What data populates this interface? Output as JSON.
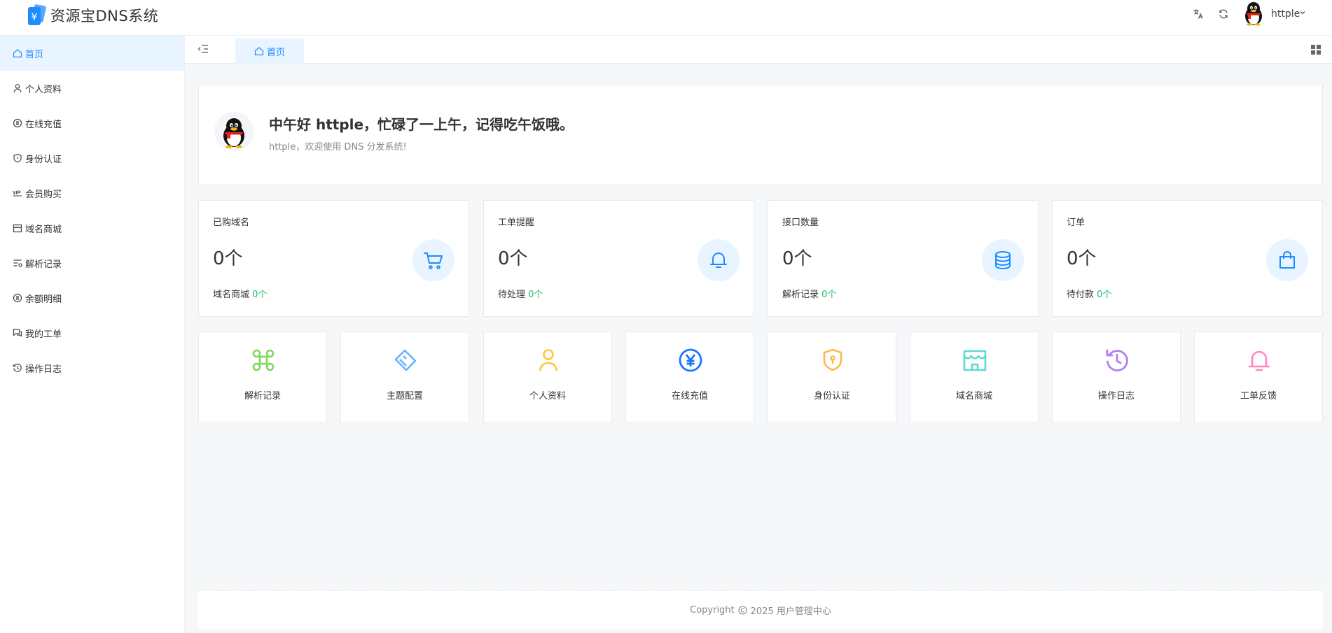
{
  "app": {
    "title": "资源宝DNS系统"
  },
  "header": {
    "username": "httple"
  },
  "sidebar": {
    "items": [
      {
        "label": "首页",
        "icon": "home-icon",
        "active": true
      },
      {
        "label": "个人资料",
        "icon": "user-icon"
      },
      {
        "label": "在线充值",
        "icon": "coin-icon"
      },
      {
        "label": "身份认证",
        "icon": "shield-icon"
      },
      {
        "label": "会员购买",
        "icon": "vip-icon"
      },
      {
        "label": "域名商城",
        "icon": "store-icon"
      },
      {
        "label": "解析记录",
        "icon": "list-icon"
      },
      {
        "label": "余额明细",
        "icon": "coin-icon"
      },
      {
        "label": "我的工单",
        "icon": "chat-icon"
      },
      {
        "label": "操作日志",
        "icon": "history-icon"
      }
    ]
  },
  "tabs": [
    {
      "label": "首页",
      "icon": "home-icon"
    }
  ],
  "welcome": {
    "title": "中午好 httple，忙碌了一上午，记得吃午饭哦。",
    "subtitle": "httple，欢迎使用 DNS 分发系统!"
  },
  "stats": [
    {
      "label": "已购域名",
      "value": "0个",
      "foot_label": "域名商城",
      "foot_value": "0个",
      "icon": "cart-icon"
    },
    {
      "label": "工单提醒",
      "value": "0个",
      "foot_label": "待处理",
      "foot_value": "0个",
      "icon": "bell-icon"
    },
    {
      "label": "接口数量",
      "value": "0个",
      "foot_label": "解析记录",
      "foot_value": "0个",
      "icon": "database-icon"
    },
    {
      "label": "订单",
      "value": "0个",
      "foot_label": "待付款",
      "foot_value": "0个",
      "icon": "shopping-bag-icon"
    }
  ],
  "quick_links": [
    {
      "label": "解析记录",
      "icon": "command-icon",
      "color": "#7ed957"
    },
    {
      "label": "主题配置",
      "icon": "brush-icon",
      "color": "#69b1ff"
    },
    {
      "label": "个人资料",
      "icon": "user-icon",
      "color": "#ffc53d"
    },
    {
      "label": "在线充值",
      "icon": "yen-coin-icon",
      "color": "#1677ff"
    },
    {
      "label": "身份认证",
      "icon": "shield-icon",
      "color": "#ffb84d"
    },
    {
      "label": "域名商城",
      "icon": "store-icon",
      "color": "#5cdbd3"
    },
    {
      "label": "操作日志",
      "icon": "history-icon",
      "color": "#b37feb"
    },
    {
      "label": "工单反馈",
      "icon": "bell-icon",
      "color": "#ff85c0"
    }
  ],
  "footer": {
    "copyright_prefix": "Copyright",
    "copyright_suffix": "2025 用户管理中心"
  },
  "colors": {
    "accent": "#1e8cff",
    "green": "#23c16b",
    "active_bg": "#e8f4ff"
  }
}
